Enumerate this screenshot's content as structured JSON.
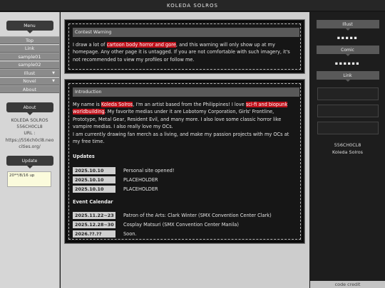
{
  "site_title": "KOLEDA SOLROS",
  "sidebar": {
    "menu_heading": "Menu",
    "items": [
      {
        "label": "Top",
        "has_dropdown": false
      },
      {
        "label": "Link",
        "has_dropdown": false
      },
      {
        "label": "sample01",
        "has_dropdown": false
      },
      {
        "label": "sample02",
        "has_dropdown": false
      },
      {
        "label": "Illust",
        "has_dropdown": true
      },
      {
        "label": "Novel",
        "has_dropdown": true
      },
      {
        "label": "About",
        "has_dropdown": false
      }
    ],
    "about_heading": "About",
    "about_name": "KOLEDA SOLROS",
    "about_id": "556CH0CL8",
    "about_url_label": "URL :",
    "about_url": "https://556ch0cl8.neocities.org/",
    "update_heading": "Update",
    "update_text": "20**/8/16 up"
  },
  "warning": {
    "heading": "Contest Warning",
    "text_1": "I draw a lot of ",
    "highlight": "cartoon body horror and gore",
    "text_2": ", and this warning will only show up at my homepage. Any other page it is untagged. If you are not comfortable with such imagery, it's not recommended to view my profiles or follow me."
  },
  "intro": {
    "heading": "Introduction",
    "p1_a": "My name is ",
    "p1_name": "Koleda Solros",
    "p1_b": ", I'm an artist based from the Philippines! I love ",
    "p1_hl": "sci-fi and biopunk worldbuilding",
    "p1_c": ". My favorite medias under it are Lobotomy Corporation, Girls' Frontline, Prototype, Metal Gear, Resident Evil, and many more. I also love some classic horror like vampire medias. I also really love my OCs.",
    "p2": "I am currently drawing fan merch as a living, and make my passion projects with my OCs at my free time.",
    "updates_title": "Updates",
    "updates": [
      {
        "date": "2025.10.10",
        "text": "Personal site opened!"
      },
      {
        "date": "2025.10.10",
        "text": "PLACEHOLDER"
      },
      {
        "date": "2025.10.10",
        "text": "PLACEHOLDER"
      }
    ],
    "events_title": "Event Calendar",
    "events": [
      {
        "date": "2025.11.22~23",
        "text": "Patron of the Arts: Clark Winter (SMX Convention Center Clark)"
      },
      {
        "date": "2025.12.28~30",
        "text": "Cosplay Matsuri (SMX Convention Center Manila)"
      },
      {
        "date": "2026.??.??",
        "text": "Soon."
      }
    ]
  },
  "right": {
    "illust_heading": "Illust",
    "illust_dots": "▪▪▪▪▪",
    "comic_heading": "Comic",
    "comic_dots": "▪▪▪▪▪▪",
    "link_heading": "Link",
    "name_id": "556CH0CL8",
    "name": "Koleda Solros",
    "credit": "code credit"
  }
}
